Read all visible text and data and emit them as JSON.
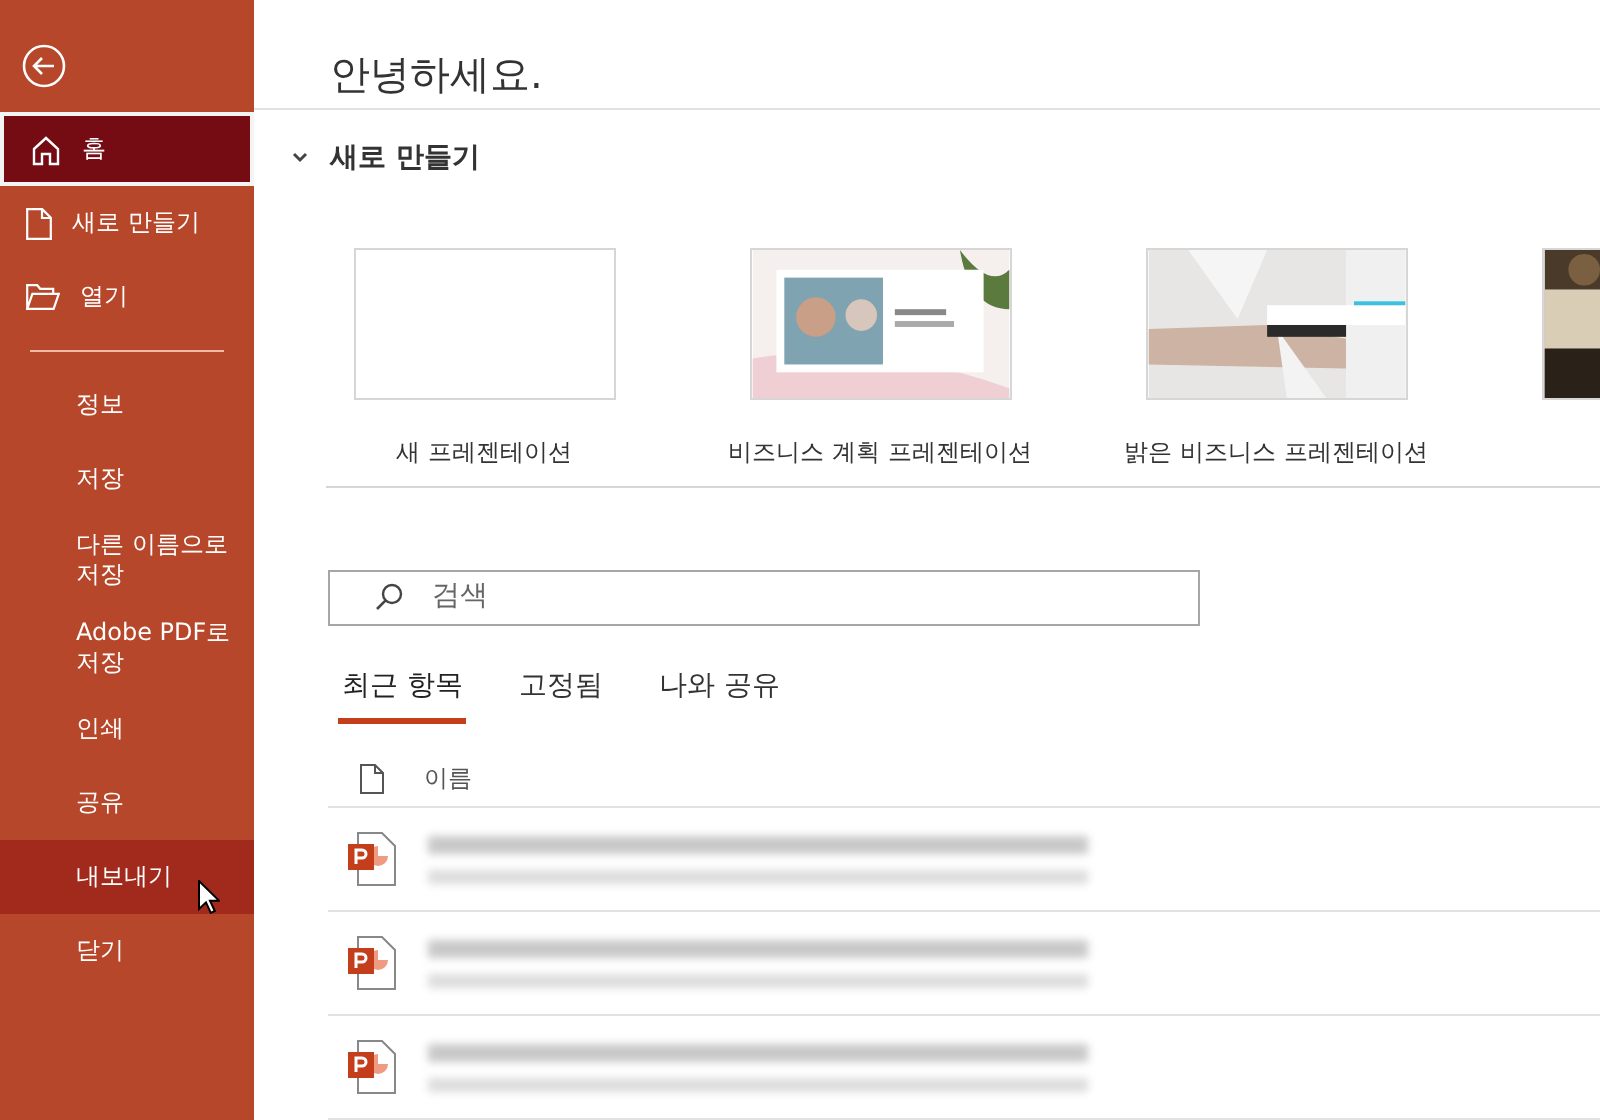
{
  "sidebar": {
    "items": [
      {
        "label": "홈",
        "kind": "home",
        "selected": true,
        "hovered": false
      },
      {
        "label": "새로 만들기",
        "kind": "new",
        "selected": false,
        "hovered": false
      },
      {
        "label": "열기",
        "kind": "open",
        "selected": false,
        "hovered": false
      },
      {
        "label": "정보",
        "kind": "plain",
        "selected": false,
        "hovered": false
      },
      {
        "label": "저장",
        "kind": "plain",
        "selected": false,
        "hovered": false
      },
      {
        "label": "다른 이름으로 저장",
        "kind": "plain",
        "selected": false,
        "hovered": false
      },
      {
        "label": "Adobe PDF로 저장",
        "kind": "plain",
        "selected": false,
        "hovered": false
      },
      {
        "label": "인쇄",
        "kind": "plain",
        "selected": false,
        "hovered": false
      },
      {
        "label": "공유",
        "kind": "plain",
        "selected": false,
        "hovered": false
      },
      {
        "label": "내보내기",
        "kind": "plain",
        "selected": false,
        "hovered": true
      },
      {
        "label": "닫기",
        "kind": "plain",
        "selected": false,
        "hovered": false
      }
    ]
  },
  "greeting": "안녕하세요.",
  "new_section": {
    "title": "새로 만들기",
    "expanded": true,
    "templates": [
      {
        "label": "새 프레젠테이션",
        "kind": "blank"
      },
      {
        "label": "비즈니스 계획 프레젠테이션",
        "kind": "picture"
      },
      {
        "label": "밝은 비즈니스 프레젠테이션",
        "kind": "picture"
      },
      {
        "kind": "picture"
      }
    ]
  },
  "search": {
    "placeholder": "검색"
  },
  "tabs": [
    {
      "label": "최근 항목",
      "selected": true
    },
    {
      "label": "고정됨",
      "selected": false
    },
    {
      "label": "나와 공유",
      "selected": false
    }
  ],
  "files": {
    "column": "이름",
    "rows": [
      {
        "redacted": true
      },
      {
        "redacted": true
      },
      {
        "redacted": true
      }
    ]
  }
}
